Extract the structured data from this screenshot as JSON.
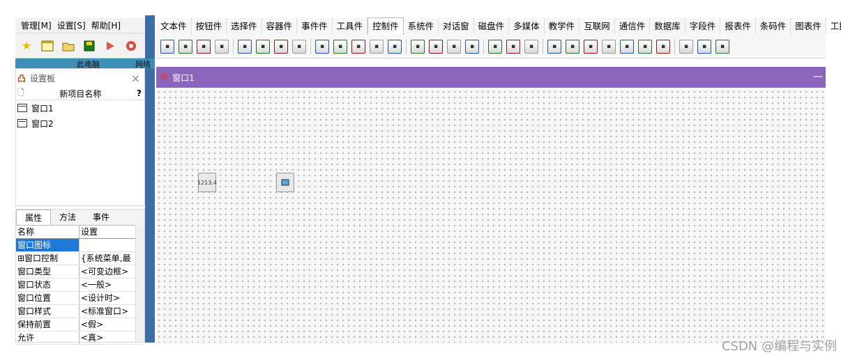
{
  "main_menu": [
    "管理[M]",
    "设置[S]",
    "帮助[H]"
  ],
  "left_toolbar_icons": [
    "star-icon",
    "window-icon",
    "folder-icon",
    "save-icon",
    "run-icon",
    "stop-icon"
  ],
  "desktop": {
    "left_label": "此电脑",
    "right_label": "网络"
  },
  "settings_panel": {
    "title": "设置板",
    "project_header": "新项目名称",
    "help": "?",
    "items": [
      "窗口1",
      "窗口2"
    ]
  },
  "property_panel": {
    "tabs": [
      "属性",
      "方法",
      "事件"
    ],
    "columns": [
      "名称",
      "设置"
    ],
    "rows": [
      {
        "name": "窗口图标",
        "value": ""
      },
      {
        "name": "⊞窗口控制",
        "value": "{系统菜单,最"
      },
      {
        "name": "窗口类型",
        "value": "<可变边框>"
      },
      {
        "name": "窗口状态",
        "value": "<一般>"
      },
      {
        "name": "窗口位置",
        "value": "<设计时>"
      },
      {
        "name": "窗口样式",
        "value": "<标准窗口>"
      },
      {
        "name": "保持前置",
        "value": "<假>"
      },
      {
        "name": "允许",
        "value": "<真>"
      }
    ]
  },
  "component_tabs": [
    "文本件",
    "按钮件",
    "选择件",
    "容器件",
    "事件件",
    "工具件",
    "控制件",
    "系统件",
    "对话窗",
    "磁盘件",
    "多媒体",
    "教学件",
    "互联网",
    "通信件",
    "数据库",
    "字段件",
    "报表件",
    "条码件",
    "图表件",
    "工控件"
  ],
  "active_component_tab": "控制件",
  "component_tools": [
    "tree-tool",
    "tree2-tool",
    "list-tool",
    "line-tool",
    "split-tool",
    "panel-tool",
    "move-tool",
    "move2-tool",
    "wave-tool",
    "xyz-tool",
    "xy-tool",
    "grid-tool",
    "matrix-tool",
    "disk-tool",
    "print-tool",
    "file-tool",
    "reel-tool",
    "box-tool",
    "switch-tool",
    "bus-tool",
    "ruler-tool",
    "slider-tool",
    "track-tool",
    "l1-tool",
    "b64-tool",
    "md5-tool",
    "num-tool",
    "curve-tool",
    "chip-tool",
    "arrow-tool"
  ],
  "design_window": {
    "title": "窗口1",
    "placed_controls": [
      {
        "name": "numeric-control",
        "label": "1213.4"
      },
      {
        "name": "chip-control",
        "label": ""
      }
    ]
  },
  "watermark": "CSDN @编程与实例"
}
